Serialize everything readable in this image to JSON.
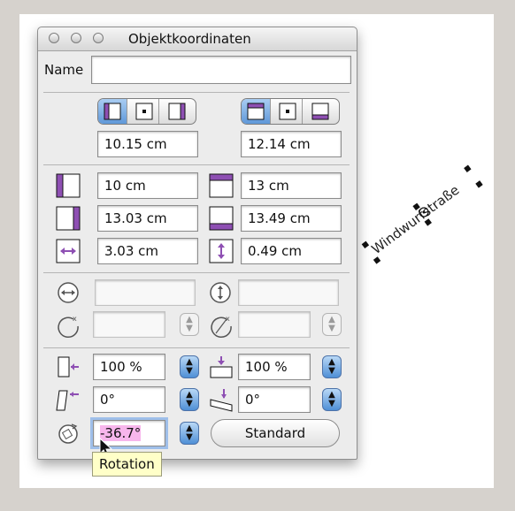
{
  "window": {
    "title": "Objektkoordinaten"
  },
  "name": {
    "label": "Name",
    "value": ""
  },
  "anchor": {
    "x_value": "10.15 cm",
    "y_value": "12.14 cm"
  },
  "position": {
    "left": "10 cm",
    "top": "13 cm",
    "right": "13.03 cm",
    "bottom": "13.49 cm",
    "width": "3.03 cm",
    "height": "0.49 cm"
  },
  "transform": {
    "scale_x": "100 %",
    "scale_y": "100 %",
    "skew_x": "0°",
    "skew_y": "0°",
    "rotation": "-36.7°"
  },
  "buttons": {
    "standard": "Standard"
  },
  "tooltip": {
    "text": "Rotation"
  },
  "canvas_object": {
    "text": "Windwurfstraße",
    "rotation_deg": -36.7
  },
  "colors": {
    "accent_purple": "#8e4fb3",
    "selection_blue": "#5f98d9",
    "highlight": "#f7b6ec"
  }
}
